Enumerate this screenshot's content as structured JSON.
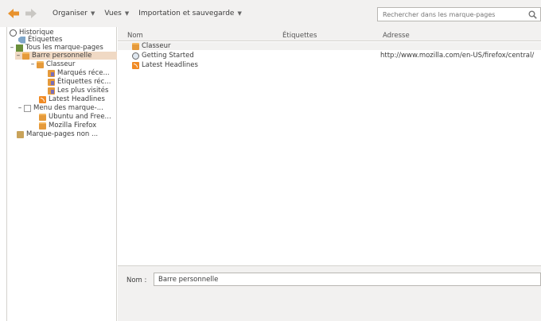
{
  "toolbar": {
    "organize_label": "Organiser",
    "views_label": "Vues",
    "import_label": "Importation et sauvegarde",
    "back_icon": "arrow-left-icon",
    "forward_icon": "arrow-right-icon"
  },
  "search": {
    "placeholder": "Rechercher dans les marque-pages",
    "icon": "search-icon"
  },
  "tree": {
    "items": [
      {
        "label": "Historique",
        "icon": "clock-icon"
      },
      {
        "label": "Étiquettes",
        "icon": "tag-icon"
      },
      {
        "label": "Tous les marque-pages",
        "icon": "library-icon"
      },
      {
        "label": "Barre personnelle",
        "icon": "folder-icon"
      },
      {
        "label": "Classeur",
        "icon": "folder-icon"
      },
      {
        "label": "Marqués réce...",
        "icon": "smart-folder-icon"
      },
      {
        "label": "Étiquettes réc...",
        "icon": "smart-folder-icon"
      },
      {
        "label": "Les plus visités",
        "icon": "smart-folder-icon"
      },
      {
        "label": "Latest Headlines",
        "icon": "rss-icon"
      },
      {
        "label": "Menu des marque-...",
        "icon": "menu-icon"
      },
      {
        "label": "Ubuntu and Free...",
        "icon": "folder-icon"
      },
      {
        "label": "Mozilla Firefox",
        "icon": "folder-icon"
      },
      {
        "label": "Marque-pages non ...",
        "icon": "unsorted-icon"
      }
    ]
  },
  "columns": {
    "name": "Nom",
    "tags": "Étiquettes",
    "address": "Adresse"
  },
  "rows": [
    {
      "name": "Classeur",
      "url": ""
    },
    {
      "name": "Getting Started",
      "url": "http://www.mozilla.com/en-US/firefox/central/"
    },
    {
      "name": "Latest Headlines",
      "url": ""
    }
  ],
  "details": {
    "name_label": "Nom :",
    "name_value": "Barre personnelle"
  },
  "colors": {
    "accent": "#f08a24",
    "selection": "#f0d9c4",
    "chrome": "#f2f1f0"
  }
}
